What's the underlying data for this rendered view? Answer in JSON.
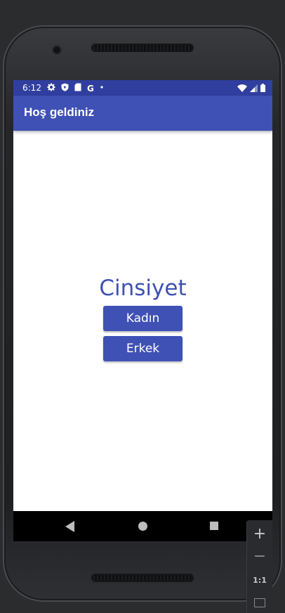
{
  "status_bar": {
    "time": "6:12",
    "icons": [
      "settings-icon",
      "shield-icon",
      "sd-card-icon",
      "google-icon",
      "dot-icon"
    ],
    "google_glyph": "G",
    "right_icons": [
      "wifi-icon",
      "signal-icon",
      "battery-icon"
    ]
  },
  "app_bar": {
    "title": "Hoş geldiniz"
  },
  "content": {
    "heading": "Cinsiyet",
    "buttons": {
      "female": "Kadın",
      "male": "Erkek"
    }
  },
  "navigation": {
    "back": "back-icon",
    "home": "home-icon",
    "recents": "recents-icon"
  },
  "zoom_controls": {
    "plus": "+",
    "minus": "−",
    "reset": "1:1"
  },
  "colors": {
    "primary": "#3f51b5",
    "primary_dark": "#303f9f",
    "nav_bar": "#000000",
    "background": "#ffffff"
  }
}
